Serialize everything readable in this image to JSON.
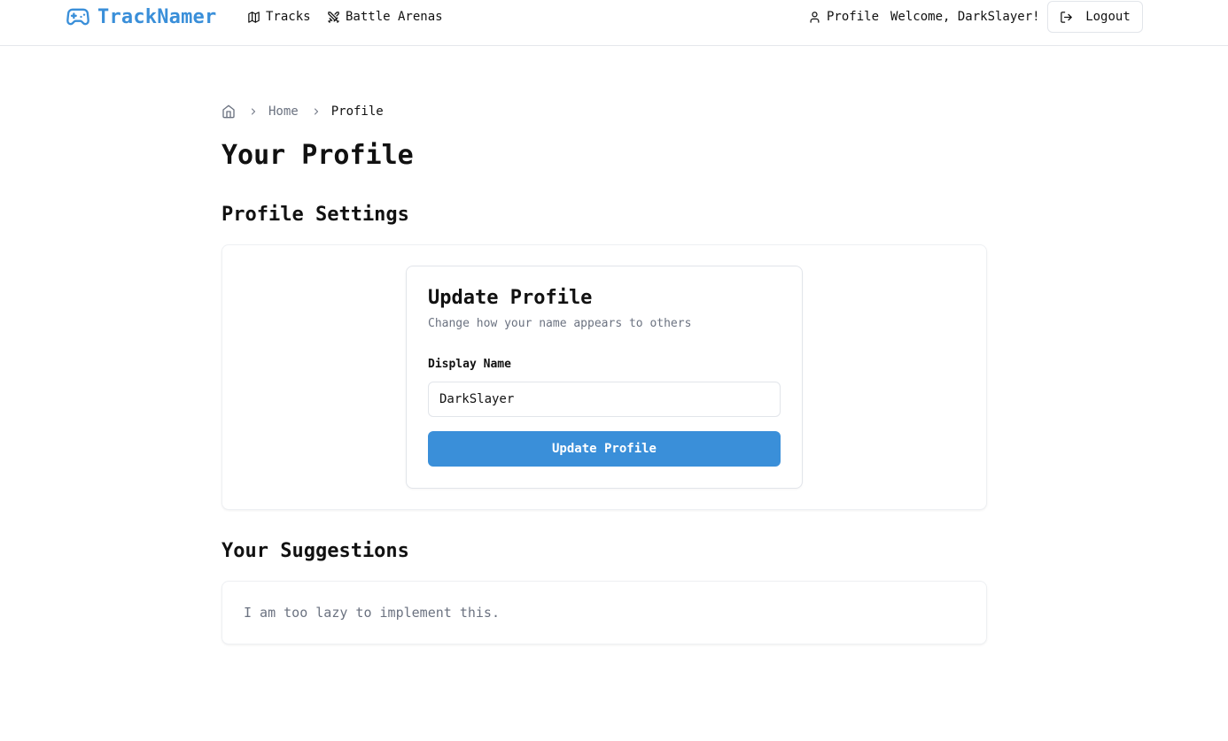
{
  "brand": {
    "name": "TrackNamer",
    "icon": "gamepad-icon",
    "color": "#3a8fd9"
  },
  "nav": {
    "tracks": {
      "label": "Tracks",
      "icon": "map-icon"
    },
    "arenas": {
      "label": "Battle Arenas",
      "icon": "crossed-swords-icon"
    },
    "profile": {
      "label": "Profile",
      "icon": "user-icon"
    },
    "welcome": "Welcome, DarkSlayer!",
    "logout": {
      "label": "Logout",
      "icon": "logout-icon"
    }
  },
  "breadcrumb": {
    "home_icon": "home-icon",
    "items": [
      {
        "label": "Home"
      },
      {
        "label": "Profile"
      }
    ]
  },
  "page": {
    "title": "Your Profile"
  },
  "settings": {
    "section_title": "Profile Settings",
    "card": {
      "title": "Update Profile",
      "description": "Change how your name appears to others",
      "field_label": "Display Name",
      "field_value": "DarkSlayer",
      "submit_label": "Update Profile"
    }
  },
  "suggestions": {
    "section_title": "Your Suggestions",
    "empty_text": "I am too lazy to implement this."
  },
  "colors": {
    "accent": "#3a8fd9",
    "muted_text": "#6b7280",
    "border": "#e2e5ea"
  }
}
